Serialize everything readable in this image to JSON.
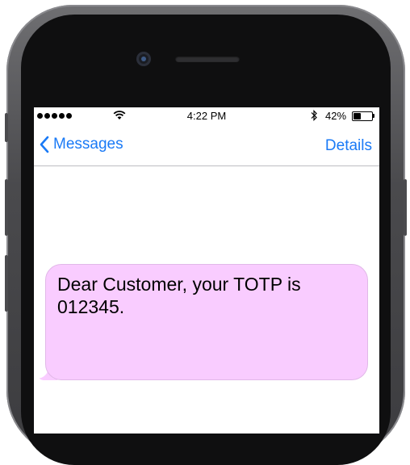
{
  "status_bar": {
    "time": "4:22 PM",
    "battery_percent": "42%",
    "battery_level": 0.42,
    "signal_dots": 5,
    "icons": [
      "wifi-icon",
      "bluetooth-icon",
      "battery-icon"
    ]
  },
  "nav": {
    "back_label": "Messages",
    "details_label": "Details",
    "accent_color": "#1a7af6"
  },
  "message": {
    "text": "Dear Customer, your TOTP is 012345.",
    "bubble_color": "#f9ccff"
  }
}
